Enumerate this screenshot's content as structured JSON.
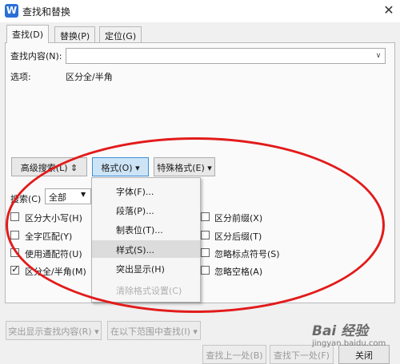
{
  "window": {
    "title": "查找和替换",
    "close_glyph": "✕",
    "app_icon_letter": "W"
  },
  "tabs": [
    {
      "label": "查找(D)"
    },
    {
      "label": "替换(P)"
    },
    {
      "label": "定位(G)"
    }
  ],
  "find": {
    "label": "查找内容(N):",
    "value": ""
  },
  "options": {
    "label": "选项:",
    "value": "区分全/半角"
  },
  "buttons": {
    "advanced": "高级搜索(L) ⇕",
    "format": "格式(O) ▾",
    "special": "特殊格式(E) ▾",
    "highlight": "突出显示查找内容(R) ▾",
    "find_in": "在以下范围中查找(I) ▾",
    "find_prev": "查找上一处(B)",
    "find_next": "查找下一处(F)",
    "close": "关闭"
  },
  "search": {
    "label": "搜索(C)",
    "value": "全部"
  },
  "checkboxes_left": [
    {
      "label": "区分大小写(H)",
      "checked": false
    },
    {
      "label": "全字匹配(Y)",
      "checked": false
    },
    {
      "label": "使用通配符(U)",
      "checked": false
    },
    {
      "label": "区分全/半角(M)",
      "checked": true
    }
  ],
  "checkboxes_right": [
    {
      "label": "区分前缀(X)",
      "checked": false
    },
    {
      "label": "区分后缀(T)",
      "checked": false
    },
    {
      "label": "忽略标点符号(S)",
      "checked": false
    },
    {
      "label": "忽略空格(A)",
      "checked": false
    }
  ],
  "format_menu": [
    {
      "label": "字体(F)...",
      "state": "normal"
    },
    {
      "label": "段落(P)...",
      "state": "normal"
    },
    {
      "label": "制表位(T)...",
      "state": "normal"
    },
    {
      "label": "样式(S)...",
      "state": "hover"
    },
    {
      "label": "突出显示(H)",
      "state": "normal"
    },
    {
      "label": "清除格式设置(C)",
      "state": "disabled"
    }
  ],
  "watermark": {
    "brand": "Bai 经验",
    "sub": "jingyan.baidu.com"
  },
  "colors": {
    "annotation": "#e21b1b",
    "button_active_border": "#3c8fd6",
    "app_icon": "#2b6fd6"
  }
}
